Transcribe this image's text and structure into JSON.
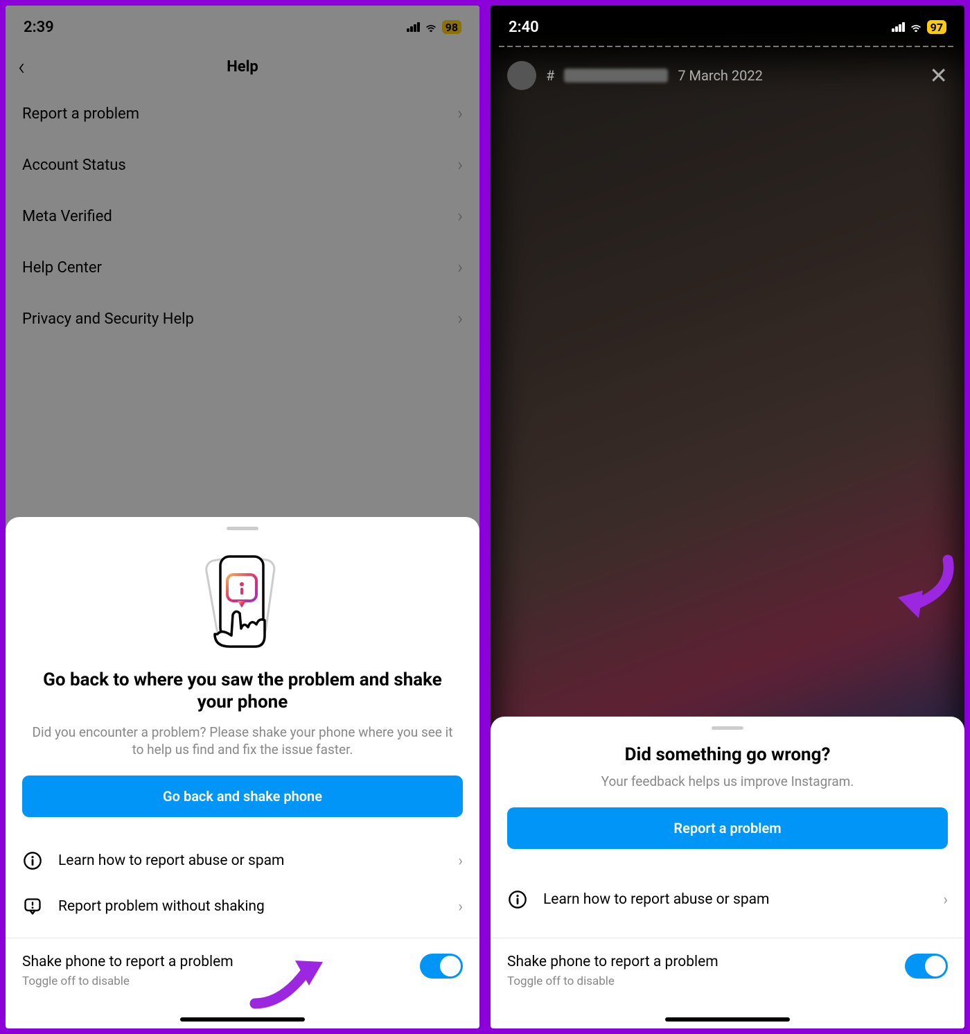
{
  "colors": {
    "accent": "#8b00d9",
    "ios_blue": "#0095f6",
    "battery": "#ffcb0e"
  },
  "screen1": {
    "status": {
      "time": "2:39",
      "battery": "98"
    },
    "header": {
      "title": "Help"
    },
    "menu": [
      {
        "label": "Report a problem"
      },
      {
        "label": "Account Status"
      },
      {
        "label": "Meta Verified"
      },
      {
        "label": "Help Center"
      },
      {
        "label": "Privacy and Security Help"
      }
    ],
    "sheet": {
      "title": "Go back to where you saw the problem and shake your phone",
      "desc": "Did you encounter a problem? Please shake your phone where you see it to help us find and fix the issue faster.",
      "primary_btn": "Go back and shake phone",
      "options": [
        {
          "icon": "info",
          "label": "Learn how to report abuse or spam"
        },
        {
          "icon": "report",
          "label": "Report problem without shaking"
        }
      ],
      "toggle": {
        "title": "Shake phone to report a problem",
        "sub": "Toggle off to disable",
        "on": true
      }
    }
  },
  "screen2": {
    "status": {
      "time": "2:40",
      "battery": "97"
    },
    "story": {
      "hash": "#",
      "date": "7 March 2022"
    },
    "sheet": {
      "title": "Did something go wrong?",
      "desc": "Your feedback helps us improve Instagram.",
      "primary_btn": "Report a problem",
      "options": [
        {
          "icon": "info",
          "label": "Learn how to report abuse or spam"
        }
      ],
      "toggle": {
        "title": "Shake phone to report a problem",
        "sub": "Toggle off to disable",
        "on": true
      }
    }
  }
}
